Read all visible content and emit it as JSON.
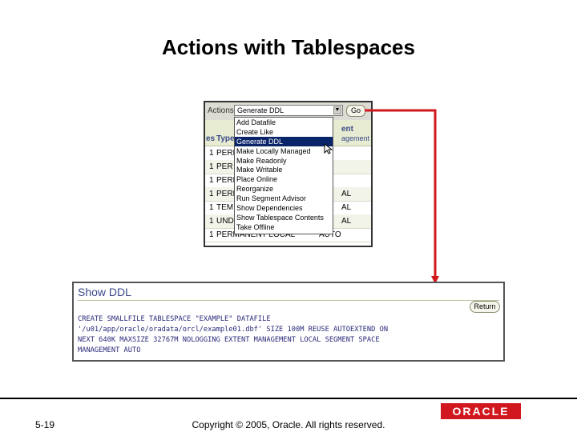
{
  "slide": {
    "title": "Actions with Tablespaces",
    "number": "5-19",
    "copyright": "Copyright © 2005, Oracle.  All rights reserved.",
    "logo": "ORACLE"
  },
  "actions": {
    "label": "Actions",
    "selected_value": "Generate DDL",
    "go_label": "Go",
    "options": [
      "Add Datafile",
      "Create Like",
      "Generate DDL",
      "Make Locally Managed",
      "Make Readonly",
      "Make Writable",
      "Place Online",
      "Reorganize",
      "Run Segment Advisor",
      "Show Dependencies",
      "Show Tablespace Contents",
      "Take Offline"
    ]
  },
  "table": {
    "header_left": "es",
    "header_type": "Type",
    "header_right_top": "ent",
    "header_right_bottom": "agement",
    "rows": [
      {
        "num": "1",
        "type": "PERI",
        "extent": ""
      },
      {
        "num": "1",
        "type": "PER",
        "extent": ""
      },
      {
        "num": "1",
        "type": "PERI",
        "extent": ""
      },
      {
        "num": "1",
        "type": "PERI",
        "extent": "AL"
      },
      {
        "num": "1",
        "type": "TEMI",
        "extent": "AL"
      },
      {
        "num": "1",
        "type": "UNDO",
        "extent": "AL"
      },
      {
        "num": "1",
        "type": "PERMANENT LOCAL",
        "extent": "AUTO"
      }
    ]
  },
  "ddl": {
    "title": "Show DDL",
    "return_label": "Return",
    "lines": [
      "CREATE SMALLFILE TABLESPACE \"EXAMPLE\" DATAFILE",
      "'/u01/app/oracle/oradata/orcl/example01.dbf' SIZE 100M REUSE AUTOEXTEND ON",
      "NEXT 640K MAXSIZE 32767M NOLOGGING EXTENT MANAGEMENT LOCAL SEGMENT SPACE",
      "MANAGEMENT AUTO"
    ]
  },
  "colors": {
    "connector": "#d0181e",
    "selected_bg": "#0a246a",
    "header_bg": "#e6ebd1",
    "ddl_text": "#29297a"
  },
  "icons": [
    "select-arrow-icon",
    "mouse-cursor-icon",
    "connector-arrow-icon"
  ]
}
